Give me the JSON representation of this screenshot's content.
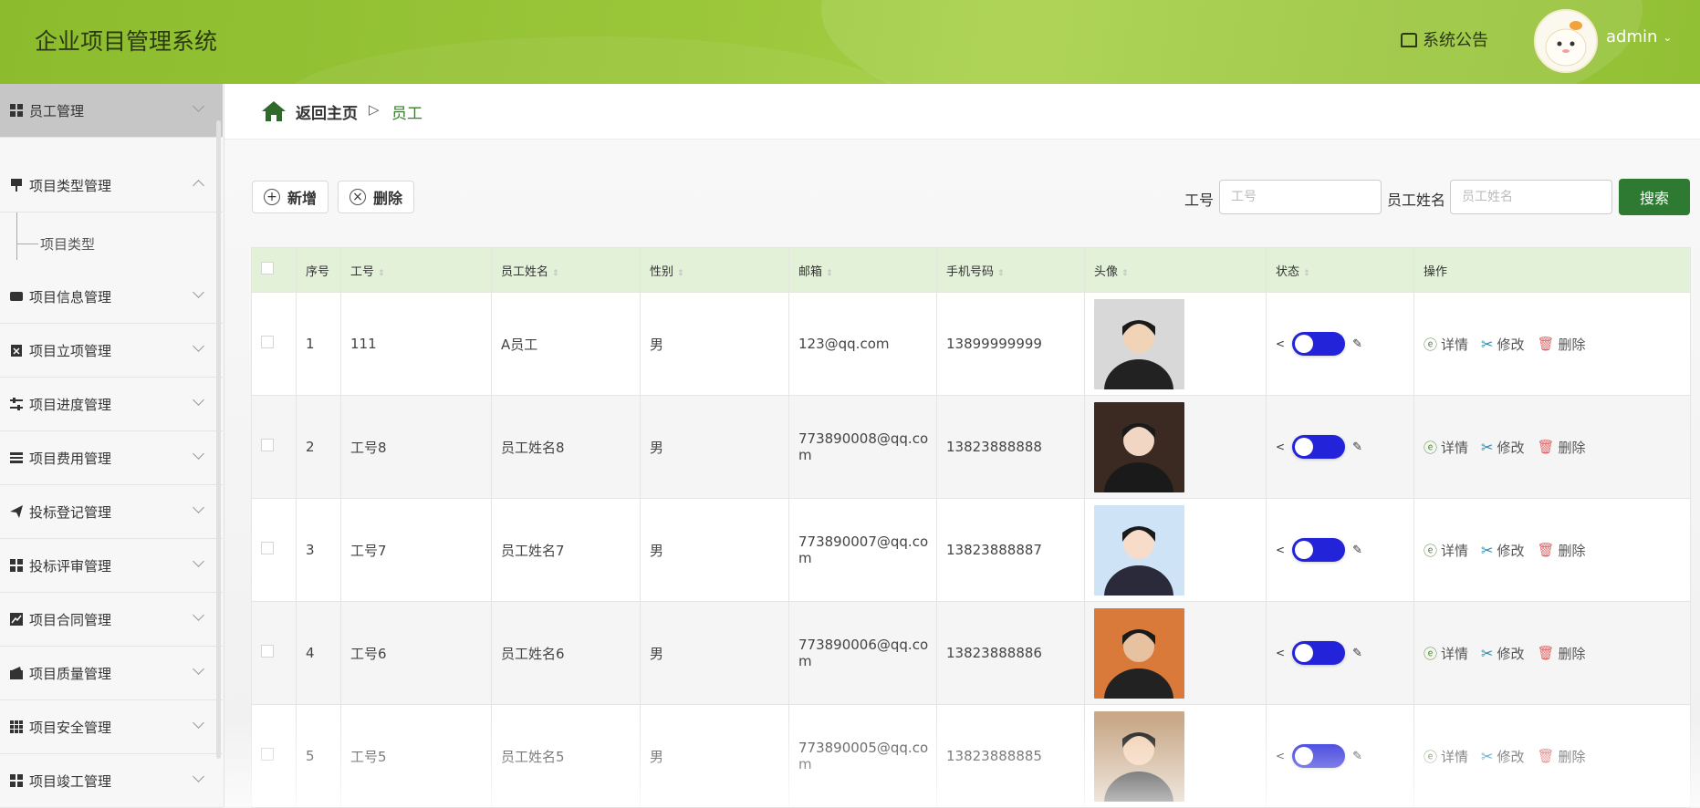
{
  "header": {
    "title": "企业项目管理系统",
    "notice": "系统公告",
    "username": "admin"
  },
  "sidebar": {
    "items": [
      {
        "label": "员工管理",
        "icon": "grid-icon",
        "expanded": false
      },
      {
        "label": "项目类型管理",
        "icon": "pin-icon",
        "expanded": true
      },
      {
        "label": "项目信息管理",
        "icon": "folder-icon",
        "expanded": false
      },
      {
        "label": "项目立项管理",
        "icon": "clipboard-icon",
        "expanded": false
      },
      {
        "label": "项目进度管理",
        "icon": "sliders-icon",
        "expanded": false
      },
      {
        "label": "项目费用管理",
        "icon": "list-icon",
        "expanded": false
      },
      {
        "label": "投标登记管理",
        "icon": "paper-plane-icon",
        "expanded": false
      },
      {
        "label": "投标评审管理",
        "icon": "grid-icon",
        "expanded": false
      },
      {
        "label": "项目合同管理",
        "icon": "chart-icon",
        "expanded": false
      },
      {
        "label": "项目质量管理",
        "icon": "wallet-icon",
        "expanded": false
      },
      {
        "label": "项目安全管理",
        "icon": "grid-dots-icon",
        "expanded": false
      },
      {
        "label": "项目竣工管理",
        "icon": "grid-icon",
        "expanded": false
      }
    ],
    "subitem": "项目类型"
  },
  "breadcrumb": {
    "home": "返回主页",
    "separator": "▷",
    "current": "员工"
  },
  "toolbar": {
    "add_label": "新增",
    "delete_label": "删除",
    "field1_label": "工号",
    "field1_placeholder": "工号",
    "field2_label": "员工姓名",
    "field2_placeholder": "员工姓名",
    "search_label": "搜索"
  },
  "table": {
    "headers": [
      "序号",
      "工号",
      "员工姓名",
      "性别",
      "邮箱",
      "手机号码",
      "头像",
      "状态",
      "操作"
    ],
    "rows": [
      {
        "idx": "1",
        "id": "111",
        "name": "A员工",
        "gender": "男",
        "email": "123@qq.com",
        "phone": "13899999999"
      },
      {
        "idx": "2",
        "id": "工号8",
        "name": "员工姓名8",
        "gender": "男",
        "email": "773890008@qq.com",
        "phone": "13823888888"
      },
      {
        "idx": "3",
        "id": "工号7",
        "name": "员工姓名7",
        "gender": "男",
        "email": "773890007@qq.com",
        "phone": "13823888887"
      },
      {
        "idx": "4",
        "id": "工号6",
        "name": "员工姓名6",
        "gender": "男",
        "email": "773890006@qq.com",
        "phone": "13823888886"
      },
      {
        "idx": "5",
        "id": "工号5",
        "name": "员工姓名5",
        "gender": "男",
        "email": "773890005@qq.com",
        "phone": "13823888885"
      }
    ],
    "op_detail": "详情",
    "op_edit": "修改",
    "op_delete": "删除"
  },
  "colors": {
    "header_green": "#9ac63a",
    "primary_green": "#2f7a33",
    "toggle_blue": "#2323d9",
    "table_head": "#e3f1d9"
  }
}
